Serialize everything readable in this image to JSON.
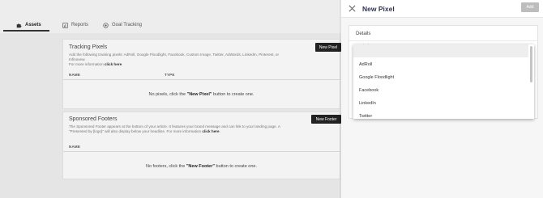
{
  "tabs": [
    {
      "label": "Assets",
      "icon": "puzzle-icon"
    },
    {
      "label": "Reports",
      "icon": "chart-icon"
    },
    {
      "label": "Goal Tracking",
      "icon": "target-icon"
    }
  ],
  "tracking_pixels": {
    "title": "Tracking Pixels",
    "desc_line1": "Add the following tracking pixels: AdRoll, Google Floodlight, Facebook, Custom Image, Twitter, AdWords, LinkedIn, Pinterest, or Infinovew.",
    "desc_line2_prefix": "For more information ",
    "desc_line2_link": "click here",
    "desc_line2_suffix": ".",
    "button": "New Pixel",
    "col_name": "NAME",
    "col_type": "TYPE",
    "empty_prefix": "No pixels, click the ",
    "empty_bold": "\"New Pixel\"",
    "empty_suffix": " button to create one."
  },
  "sponsored_footers": {
    "title": "Sponsored Footers",
    "desc_line1": "The Sponsored Footer appears at the bottom of your article. It features your brand message and can link to your landing page. A",
    "desc_line2": "\"Presented by [logo]\" will also display below your headline. For more information ",
    "desc_line2_link": "click here",
    "desc_line2_suffix": ".",
    "button": "New Footer",
    "col_name": "NAME",
    "empty_prefix": "No footers, click the ",
    "empty_bold": "\"New Footer\"",
    "empty_suffix": " button to create one."
  },
  "panel": {
    "title": "New Pixel",
    "add_button": "Add",
    "section_title": "Details",
    "peek_text": "Pixel type",
    "dropdown_options": [
      "AdRoll",
      "Google Floodlight",
      "Facebook",
      "LinkedIn",
      "Twitter"
    ]
  },
  "colors": {
    "panel_title": "#2d3550",
    "dark_button": "#222222",
    "disabled_button": "#bdbdbd"
  }
}
